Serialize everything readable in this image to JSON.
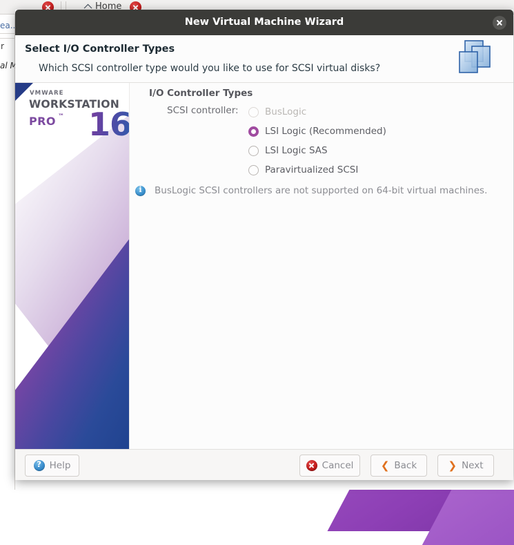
{
  "background": {
    "tab_label": "Home",
    "home_icon": "home-icon",
    "close_icon": "close-icon",
    "text_fragments": [
      {
        "text": "ea...",
        "style": "link"
      },
      {
        "text": "r",
        "style": "plain"
      },
      {
        "text": "al M",
        "style": "italic"
      }
    ]
  },
  "dialog": {
    "titlebar": {
      "title": "New Virtual Machine Wizard",
      "close_icon": "close-icon"
    },
    "header": {
      "title": "Select I/O Controller Types",
      "subtitle": "Which SCSI controller type would you like to use for SCSI virtual disks?",
      "icon": "virtual-disks-icon"
    },
    "sidebar": {
      "vendor": "VMWARE",
      "product": "WORKSTATION",
      "edition": "PRO",
      "trademark": "™",
      "version": "16"
    },
    "content": {
      "section_label": "I/O Controller Types",
      "field_label": "SCSI controller:",
      "options": [
        {
          "label": "BusLogic",
          "selected": false,
          "disabled": true
        },
        {
          "label": "LSI Logic (Recommended)",
          "selected": true,
          "disabled": false
        },
        {
          "label": "LSI Logic SAS",
          "selected": false,
          "disabled": false
        },
        {
          "label": "Paravirtualized SCSI",
          "selected": false,
          "disabled": false
        }
      ],
      "info": {
        "icon": "info-icon",
        "message": "BusLogic SCSI controllers are not supported on 64-bit virtual machines."
      }
    },
    "footer": {
      "help_label": "Help",
      "cancel_label": "Cancel",
      "back_label": "Back",
      "next_label": "Next",
      "back_chevron": "❮",
      "next_chevron": "❯"
    }
  },
  "colors": {
    "titlebar_bg": "#3b3b38",
    "accent_purple": "#a04ba0",
    "info_blue": "#3e94d0",
    "chevron_orange": "#e0701e",
    "cancel_red": "#c01a1a"
  }
}
